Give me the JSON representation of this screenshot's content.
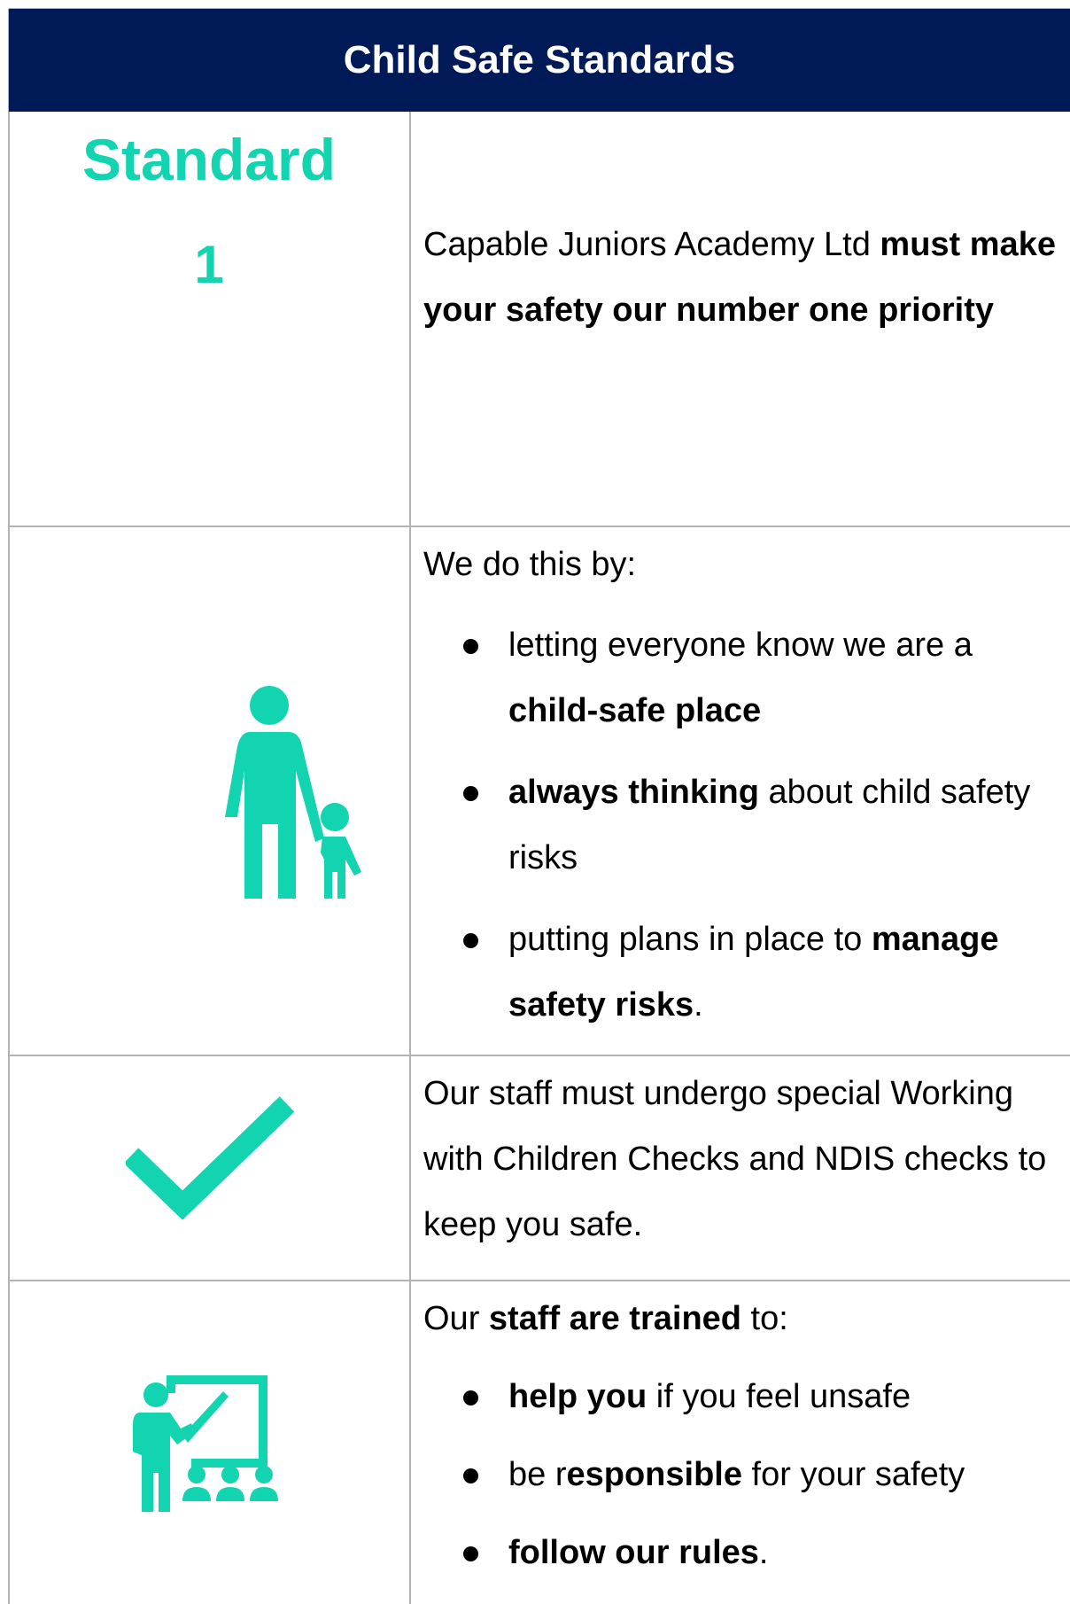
{
  "header": {
    "title": "Child Safe Standards"
  },
  "standard": {
    "word": "Standard",
    "number": "1"
  },
  "intro": {
    "prefix": " Capable Juniors Academy Ltd ",
    "bold": "must make your safety our number one priority"
  },
  "section_do": {
    "lead": "We do this by:",
    "items": [
      {
        "pre": "letting everyone know we are a ",
        "bold": "child-safe place",
        "post": ""
      },
      {
        "pre": "",
        "bold": "always thinking",
        "post": " about child safety risks"
      },
      {
        "pre": "putting plans in place to ",
        "bold": "manage safety risks",
        "post": "."
      }
    ]
  },
  "section_checks": {
    "text": "Our staff must undergo special Working with Children Checks and NDIS checks to keep you safe."
  },
  "section_training": {
    "lead_pre": "Our ",
    "lead_bold": "staff are trained",
    "lead_post": " to:",
    "items": [
      {
        "pre": "",
        "bold": "help you",
        "post": " if you feel unsafe"
      },
      {
        "pre": "be r",
        "bold": "esponsible",
        "post": " for your safety"
      },
      {
        "pre": "",
        "bold": "follow our rules",
        "post": "."
      }
    ]
  },
  "icons": {
    "row2": "adult-with-child-icon",
    "row3": "checkmark-icon",
    "row4": "teacher-at-board-icon"
  },
  "colors": {
    "header_bg": "#001a57",
    "accent": "#12d4b0",
    "grid": "#b3b3b3"
  }
}
